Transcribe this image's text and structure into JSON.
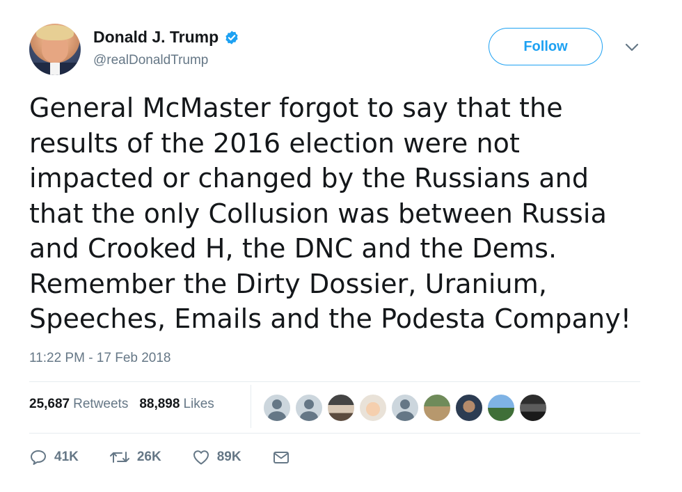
{
  "author": {
    "display_name": "Donald J. Trump",
    "handle": "@realDonaldTrump",
    "verified": true
  },
  "header": {
    "follow_label": "Follow"
  },
  "tweet": {
    "lines": [
      "General McMaster forgot to say that the",
      "results of the 2016 election were not",
      "impacted or changed by the Russians and",
      "that the only Collusion was between Russia",
      "and Crooked H, the DNC and the Dems.",
      "Remember the Dirty Dossier, Uranium,",
      "Speeches, Emails and the Podesta Company!"
    ],
    "timestamp": "11:22 PM - 17 Feb 2018"
  },
  "stats": {
    "retweets_count": "25,687",
    "retweets_label": "Retweets",
    "likes_count": "88,898",
    "likes_label": "Likes"
  },
  "likers": {
    "count_shown": 9
  },
  "actions": {
    "reply_count": "41K",
    "retweet_count": "26K",
    "like_count": "89K"
  },
  "colors": {
    "accent": "#1da1f2",
    "secondary_text": "#657786",
    "primary_text": "#14171a",
    "divider": "#e6ecf0"
  },
  "icons": [
    "verified-badge-icon",
    "chevron-down-icon",
    "reply-icon",
    "retweet-icon",
    "heart-icon",
    "envelope-icon"
  ]
}
